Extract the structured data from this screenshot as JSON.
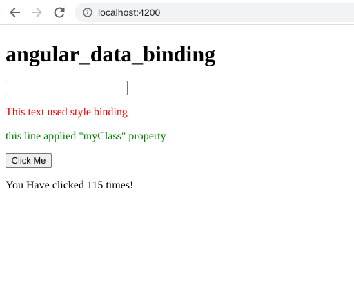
{
  "browser": {
    "url": "localhost:4200"
  },
  "page": {
    "title": "angular_data_binding",
    "input_value": "",
    "style_binding_text": "This text used style binding",
    "class_binding_text": "this line applied \"myClass\" property",
    "button_label": "Click Me",
    "click_count_text": "You Have clicked 115 times!"
  },
  "colors": {
    "style_binding": "#ff0000",
    "class_binding": "#008000"
  },
  "icons": [
    "back-arrow-icon",
    "forward-arrow-icon",
    "reload-icon",
    "info-icon"
  ]
}
